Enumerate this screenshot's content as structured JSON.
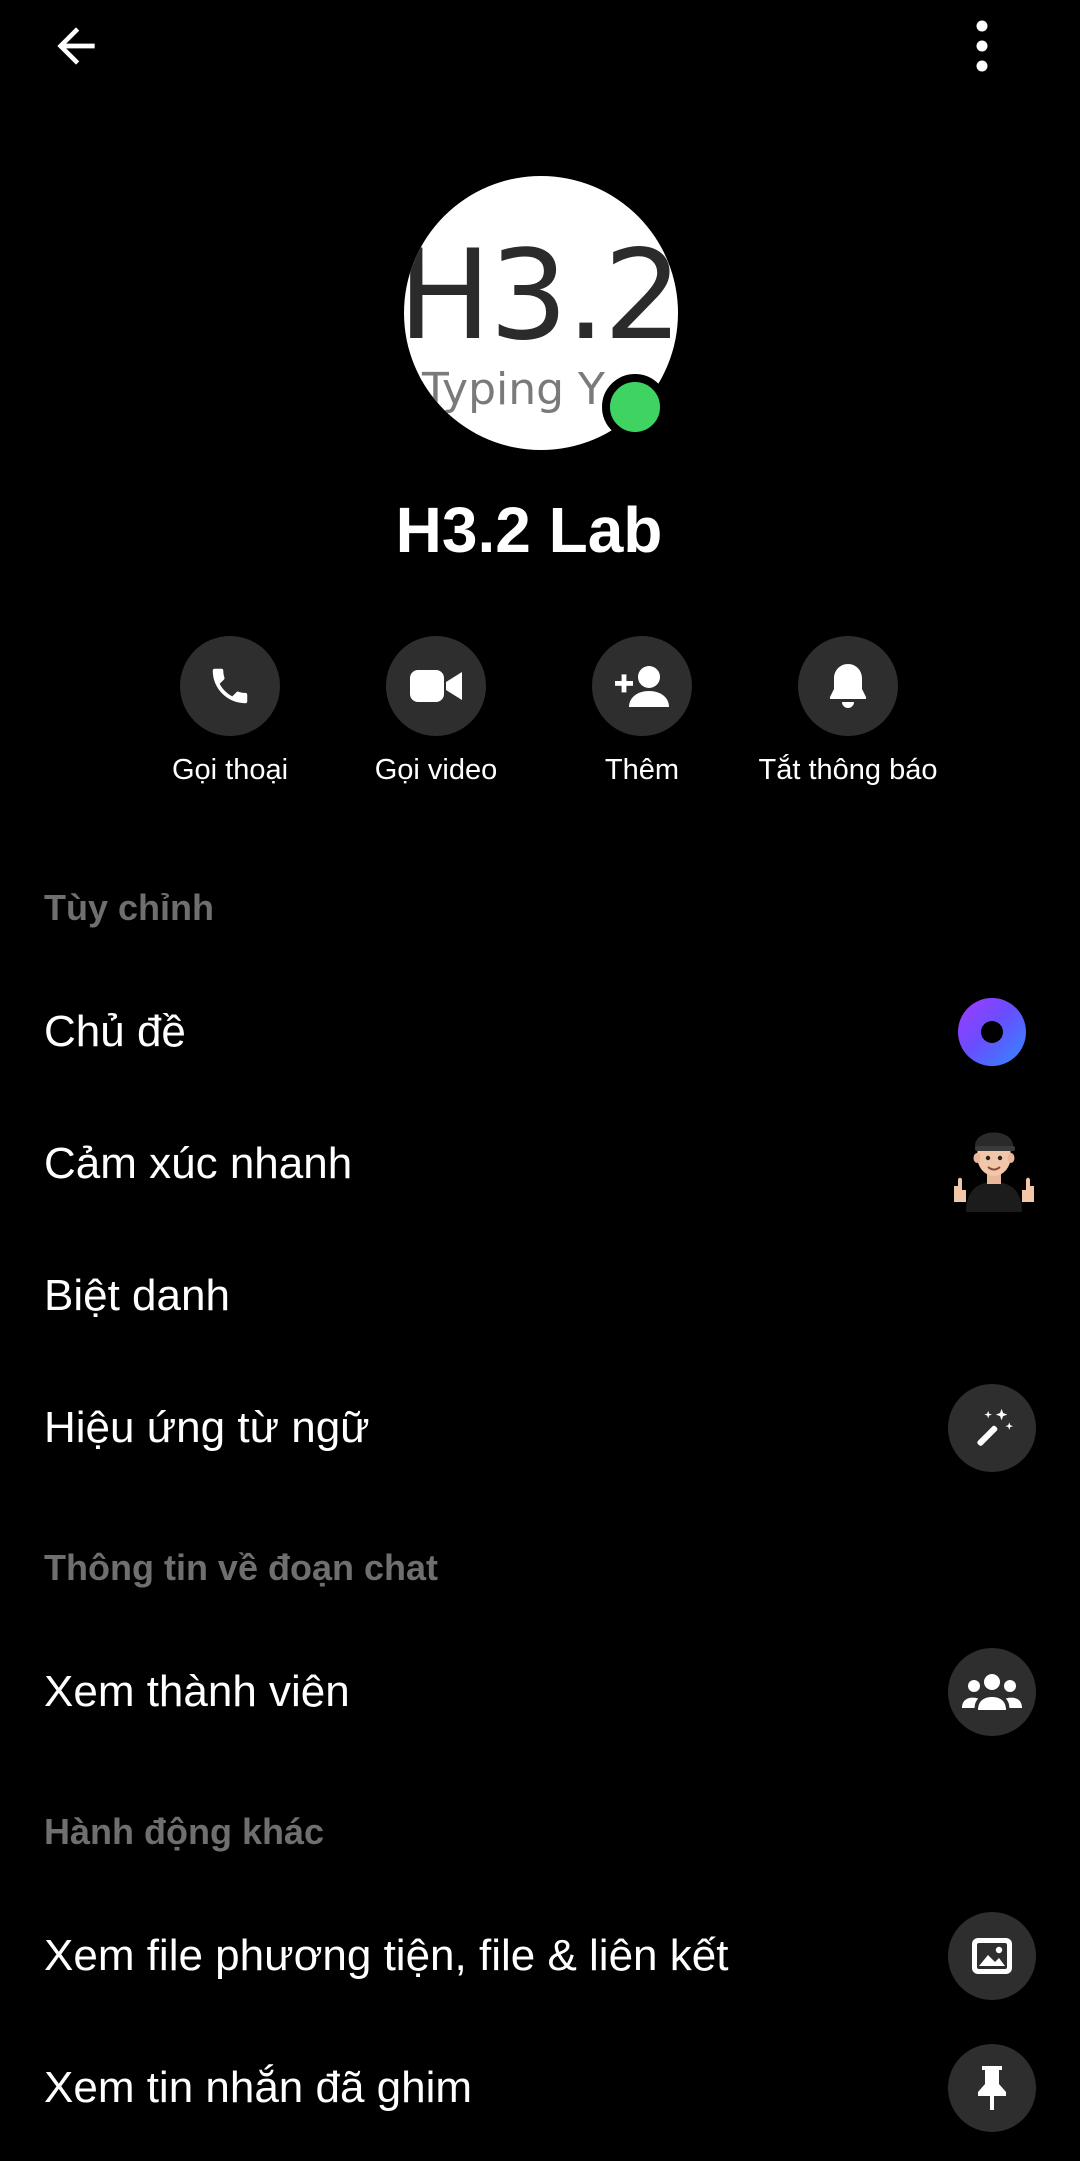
{
  "header": {
    "back_icon": "arrow-left-icon",
    "more_icon": "kebab-menu-icon"
  },
  "profile": {
    "avatar_text_main": "H3.2",
    "avatar_text_sub": "Typing Y",
    "name": "H3.2 Lab",
    "online_color": "#3fd462"
  },
  "actions": [
    {
      "label": "Gọi thoại",
      "icon": "phone-icon"
    },
    {
      "label": "Gọi video",
      "icon": "video-camera-icon"
    },
    {
      "label": "Thêm",
      "icon": "add-person-icon"
    },
    {
      "label": "Tắt thông báo",
      "icon": "bell-icon"
    }
  ],
  "sections": {
    "customize": {
      "title": "Tùy chỉnh",
      "items": [
        {
          "label": "Chủ đề",
          "icon": "theme-swatch-icon"
        },
        {
          "label": "Cảm xúc nhanh",
          "icon": "thumbs-up-avatar-icon"
        },
        {
          "label": "Biệt danh"
        },
        {
          "label": "Hiệu ứng từ ngữ",
          "icon": "magic-wand-icon"
        }
      ]
    },
    "chat_info": {
      "title": "Thông tin về đoạn chat",
      "items": [
        {
          "label": "Xem thành viên",
          "icon": "people-icon"
        }
      ]
    },
    "other_actions": {
      "title": "Hành động khác",
      "items": [
        {
          "label": "Xem file phương tiện, file & liên kết",
          "icon": "image-icon"
        },
        {
          "label": "Xem tin nhắn đã ghim",
          "icon": "pin-icon"
        }
      ]
    }
  },
  "colors": {
    "background": "#000000",
    "icon_circle": "#2e2e2e",
    "section_header": "#6f6f6f",
    "text": "#ffffff"
  }
}
